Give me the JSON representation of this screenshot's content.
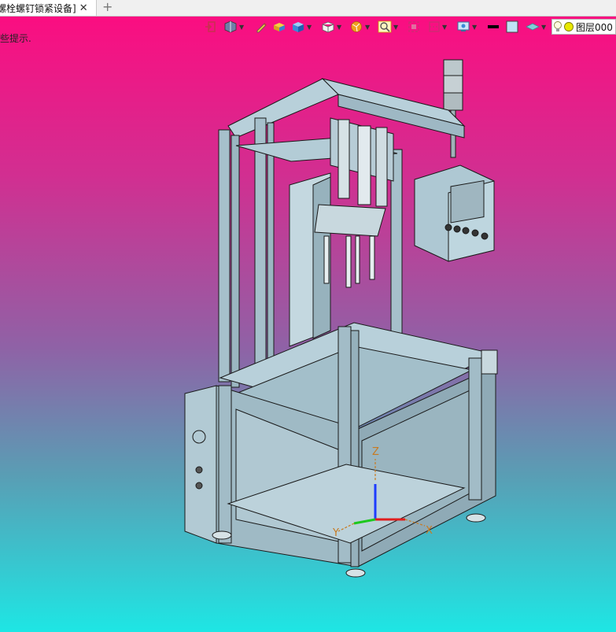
{
  "tab": {
    "title": "螺栓螺钉锁紧设备]",
    "close_glyph": "✕",
    "add_glyph": "+"
  },
  "hint": {
    "text": "些提示."
  },
  "toolbar": {
    "icons": [
      "exit-icon",
      "view-orientation-icon",
      "sketch-pen-icon",
      "shaded-solid-icon",
      "solid-cube-icon",
      "wireframe-cube-icon",
      "render-mode-icon",
      "zoom-icon",
      "fit-view-icon",
      "section-view-icon",
      "display-settings-icon",
      "line-color-swatch",
      "fill-color-swatch",
      "layer-icon"
    ],
    "line_color": "#000000",
    "fill_color": "#bfe3f5"
  },
  "layer": {
    "label": "图层000",
    "bulb_icon": "lightbulb-icon",
    "status_color": "#e8e800"
  },
  "viewport": {
    "triad": {
      "x_label": "X",
      "y_label": "Y",
      "z_label": "Z",
      "x_color": "#e01e1e",
      "y_color": "#1ec81e",
      "z_color": "#1e3cff"
    },
    "model_color": "#a9c6d2"
  }
}
